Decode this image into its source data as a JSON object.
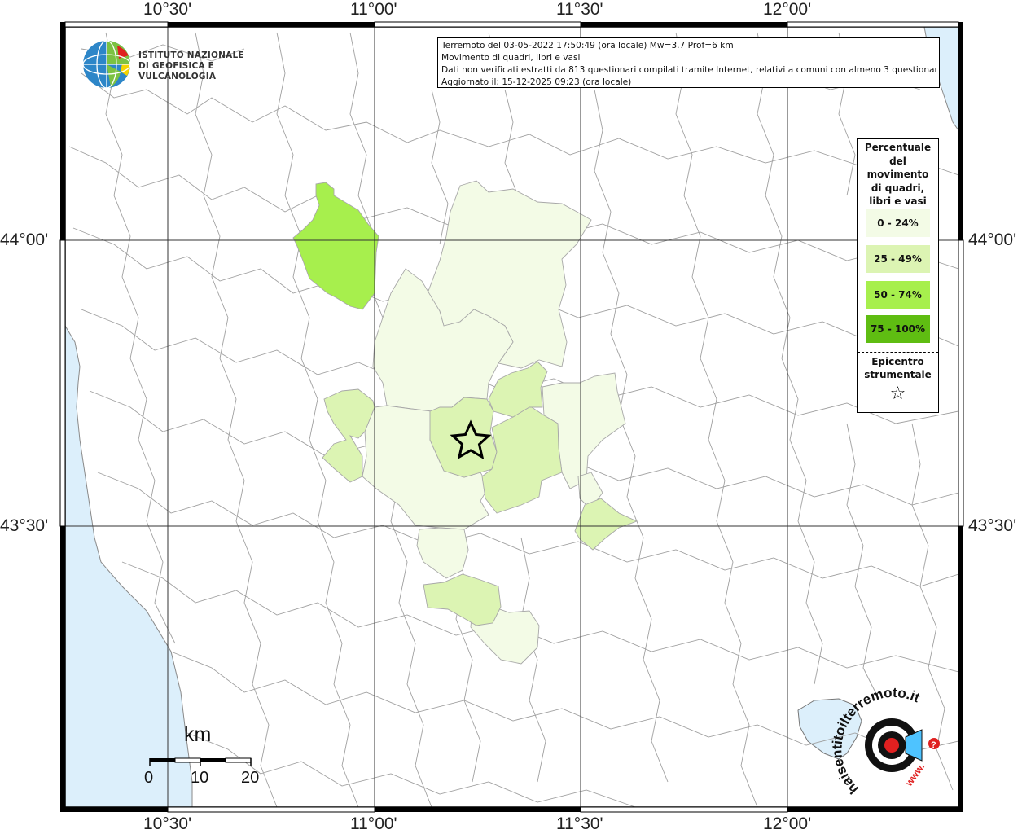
{
  "map": {
    "lon_labels": [
      "10°30'",
      "11°00'",
      "11°30'",
      "12°00'"
    ],
    "lat_labels": [
      "44°00'",
      "43°30'"
    ]
  },
  "info": {
    "line1": "Terremoto del 03-05-2022 17:50:49 (ora locale) Mw=3.7 Prof=6 km",
    "line2": "Movimento di quadri, libri e vasi",
    "line3": "Dati non verificati estratti da 813 questionari compilati tramite Internet, relativi a comuni con almeno 3 questionari.",
    "line4": "Aggiornato il: 15-12-2025 09:23 (ora locale)"
  },
  "logo": {
    "line1": "ISTITUTO NAZIONALE",
    "line2": "DI GEOFISICA E VULCANOLOGIA"
  },
  "legend": {
    "title_lines": [
      "Percentuale",
      "del",
      "movimento",
      "di quadri,",
      "libri e vasi"
    ],
    "classes": [
      {
        "label": "0 - 24%",
        "color": "#f3fbe6"
      },
      {
        "label": "25 - 49%",
        "color": "#dcf4b3"
      },
      {
        "label": "50 - 74%",
        "color": "#a7ef4d"
      },
      {
        "label": "75 - 100%",
        "color": "#5fbd12"
      }
    ],
    "epicenter_line1": "Epicentro",
    "epicenter_line2": "strumentale",
    "epicenter_symbol": "☆"
  },
  "scale": {
    "unit": "km",
    "labels": [
      "0",
      "10",
      "20"
    ]
  },
  "colors": {
    "sea": "#dceffb",
    "land": "#ffffff",
    "boundary": "#9a9a9a",
    "class1": "#f3fbe6",
    "class2": "#dcf4b3",
    "class3": "#a7ef4d"
  },
  "badge": {
    "text": "haisentitoilterremoto.it",
    "url_text": "www.",
    "question": "?"
  }
}
